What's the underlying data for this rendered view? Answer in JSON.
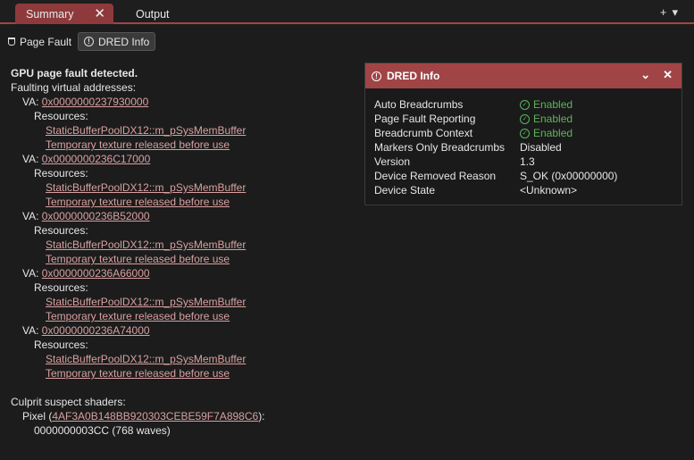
{
  "tabs": [
    {
      "label": "Summary"
    },
    {
      "label": "Output"
    }
  ],
  "tabbar_actions": {
    "add": "+",
    "menu": "▾"
  },
  "toolbar": {
    "page_fault_label": "Page Fault",
    "dred_label": "DRED Info"
  },
  "summary": {
    "heading": "GPU page fault detected.",
    "faulting_label": "Faulting virtual addresses:",
    "va_prefix": "VA:",
    "resources_label": "Resources:",
    "addresses": [
      {
        "va": "0x0000000237930000",
        "resources": [
          "StaticBufferPoolDX12::m_pSysMemBuffer",
          "Temporary texture released before use"
        ]
      },
      {
        "va": "0x0000000236C17000",
        "resources": [
          "StaticBufferPoolDX12::m_pSysMemBuffer",
          "Temporary texture released before use"
        ]
      },
      {
        "va": "0x0000000236B52000",
        "resources": [
          "StaticBufferPoolDX12::m_pSysMemBuffer",
          "Temporary texture released before use"
        ]
      },
      {
        "va": "0x0000000236A66000",
        "resources": [
          "StaticBufferPoolDX12::m_pSysMemBuffer",
          "Temporary texture released before use"
        ]
      },
      {
        "va": "0x0000000236A74000",
        "resources": [
          "StaticBufferPoolDX12::m_pSysMemBuffer",
          "Temporary texture released before use"
        ]
      }
    ],
    "culprit_label": "Culprit suspect shaders:",
    "shader_prefix": "Pixel (",
    "shader_hash": "4AF3A0B148BB920303CEBE59F7A898C6",
    "shader_suffix": "):",
    "shader_detail": "0000000003CC (768 waves)"
  },
  "dred_panel": {
    "title": "DRED Info",
    "properties": [
      {
        "key": "Auto Breadcrumbs",
        "value": "Enabled",
        "status": "ok"
      },
      {
        "key": "Page Fault Reporting",
        "value": "Enabled",
        "status": "ok"
      },
      {
        "key": "Breadcrumb Context",
        "value": "Enabled",
        "status": "ok"
      },
      {
        "key": "Markers Only Breadcrumbs",
        "value": "Disabled",
        "status": "plain"
      },
      {
        "key": "Version",
        "value": "1.3",
        "status": "plain"
      },
      {
        "key": "Device Removed Reason",
        "value": "S_OK (0x00000000)",
        "status": "plain"
      },
      {
        "key": "Device State",
        "value": "<Unknown>",
        "status": "plain"
      }
    ]
  },
  "colors": {
    "accent": "#a14446",
    "active_tab": "#8e3a3c",
    "link": "#d9a0a0",
    "enabled": "#5bb55b",
    "background": "#1c1c1c"
  }
}
